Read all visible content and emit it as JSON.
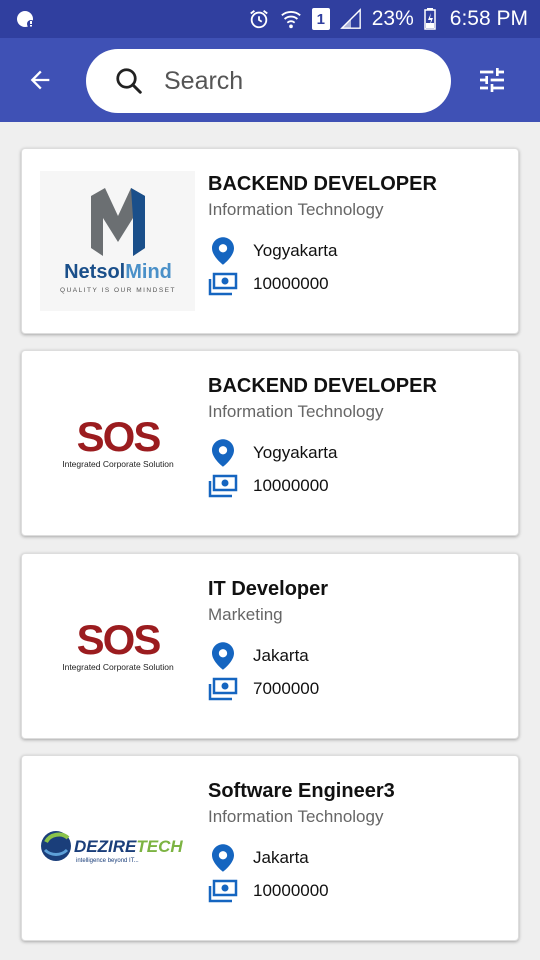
{
  "status_bar": {
    "battery": "23%",
    "time": "6:58 PM",
    "sim_label": "1"
  },
  "search": {
    "placeholder": "Search"
  },
  "jobs": [
    {
      "title": "BACKEND DEVELOPER",
      "category": "Information Technology",
      "location": "Yogyakarta",
      "salary": "10000000",
      "logo": {
        "kind": "netsolmind",
        "name": "NetsolMind",
        "name_part1": "Netsol",
        "name_part2": "Mind",
        "tagline": "QUALITY IS OUR MINDSET"
      }
    },
    {
      "title": "BACKEND DEVELOPER",
      "category": "Information Technology",
      "location": "Yogyakarta",
      "salary": "10000000",
      "logo": {
        "kind": "sos",
        "name": "SOS",
        "tagline": "Integrated Corporate Solution"
      }
    },
    {
      "title": "IT Developer",
      "category": "Marketing",
      "location": "Jakarta",
      "salary": "7000000",
      "logo": {
        "kind": "sos",
        "name": "SOS",
        "tagline": "Integrated Corporate Solution"
      }
    },
    {
      "title": "Software Engineer3",
      "category": "Information Technology",
      "location": "Jakarta",
      "salary": "10000000",
      "logo": {
        "kind": "dezire",
        "name": "DEZIRETECH",
        "name_part1": "DEZIRE",
        "name_part2": "TECH",
        "tagline": "intelligence beyond IT..."
      }
    }
  ],
  "colors": {
    "status_bar": "#303f9f",
    "app_bar": "#3f51b5",
    "icon_blue": "#1565c0",
    "sos_red": "#9b1c1f"
  }
}
